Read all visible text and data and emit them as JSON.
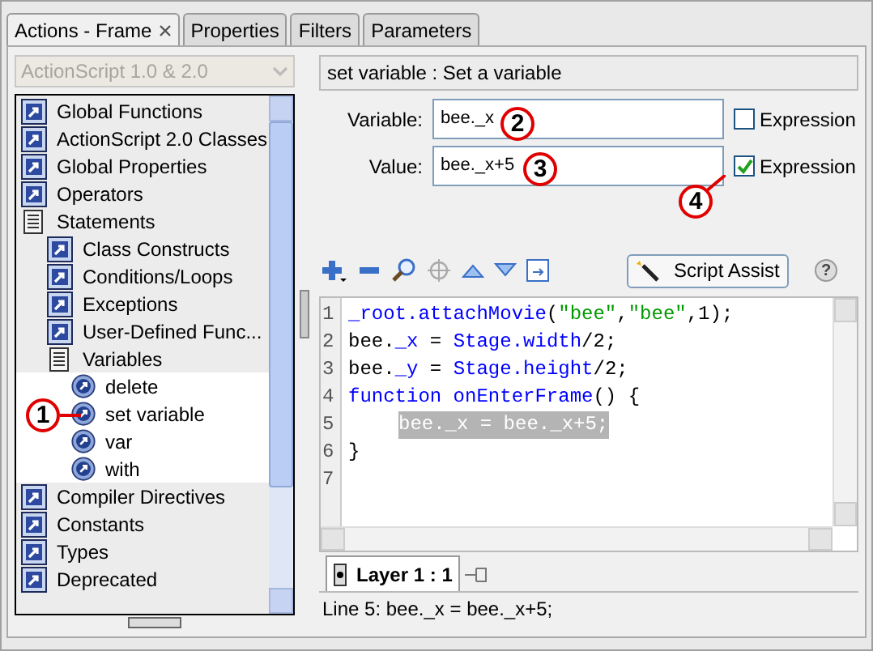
{
  "tabs": [
    {
      "label": "Actions - Frame",
      "selected": true,
      "closable": true
    },
    {
      "label": "Properties",
      "selected": false,
      "closable": false
    },
    {
      "label": "Filters",
      "selected": false,
      "closable": false
    },
    {
      "label": "Parameters",
      "selected": false,
      "closable": false
    }
  ],
  "language_select": {
    "value": "ActionScript 1.0 & 2.0",
    "disabled": true
  },
  "toolbox": [
    {
      "label": "Global Functions",
      "kind": "category"
    },
    {
      "label": "ActionScript 2.0 Classes",
      "kind": "category"
    },
    {
      "label": "Global Properties",
      "kind": "category"
    },
    {
      "label": "Operators",
      "kind": "category"
    },
    {
      "label": "Statements",
      "kind": "book",
      "children": [
        {
          "label": "Class Constructs",
          "kind": "category"
        },
        {
          "label": "Conditions/Loops",
          "kind": "category"
        },
        {
          "label": "Exceptions",
          "kind": "category"
        },
        {
          "label": "User-Defined Func...",
          "kind": "category"
        },
        {
          "label": "Variables",
          "kind": "book",
          "children": [
            {
              "label": "delete",
              "kind": "action"
            },
            {
              "label": "set variable",
              "kind": "action"
            },
            {
              "label": "var",
              "kind": "action"
            },
            {
              "label": "with",
              "kind": "action"
            }
          ]
        }
      ]
    },
    {
      "label": "Compiler Directives",
      "kind": "category"
    },
    {
      "label": "Constants",
      "kind": "category"
    },
    {
      "label": "Types",
      "kind": "category"
    },
    {
      "label": "Deprecated",
      "kind": "category"
    }
  ],
  "description": "set variable : Set a variable",
  "fields": [
    {
      "label": "Variable:",
      "value": "bee._x",
      "option": "Expression",
      "checked": false
    },
    {
      "label": "Value:",
      "value": "bee._x+5",
      "option": "Expression",
      "checked": true
    }
  ],
  "script_assist": "Script Assist",
  "help": "?",
  "code": [
    {
      "number": "1",
      "selected": false,
      "tokens": [
        {
          "kind": "keyword",
          "text": "_root.attachMovie"
        },
        {
          "kind": "plain",
          "text": "("
        },
        {
          "kind": "string",
          "text": "\"bee\""
        },
        {
          "kind": "plain",
          "text": ","
        },
        {
          "kind": "string",
          "text": "\"bee\""
        },
        {
          "kind": "plain",
          "text": ",1);"
        }
      ]
    },
    {
      "number": "2",
      "selected": false,
      "tokens": [
        {
          "kind": "plain",
          "text": "bee."
        },
        {
          "kind": "keyword",
          "text": "_x"
        },
        {
          "kind": "plain",
          "text": " = "
        },
        {
          "kind": "keyword",
          "text": "Stage.width"
        },
        {
          "kind": "plain",
          "text": "/2;"
        }
      ]
    },
    {
      "number": "3",
      "selected": false,
      "tokens": [
        {
          "kind": "plain",
          "text": "bee."
        },
        {
          "kind": "keyword",
          "text": "_y"
        },
        {
          "kind": "plain",
          "text": " = "
        },
        {
          "kind": "keyword",
          "text": "Stage.height"
        },
        {
          "kind": "plain",
          "text": "/2;"
        }
      ]
    },
    {
      "number": "4",
      "selected": false,
      "tokens": [
        {
          "kind": "keyword",
          "text": "function onEnterFrame"
        },
        {
          "kind": "plain",
          "text": "() {"
        }
      ]
    },
    {
      "number": "5",
      "selected": true,
      "indented": true,
      "tokens": [
        {
          "kind": "plain",
          "text": "bee._x = bee._x+5;"
        }
      ]
    },
    {
      "number": "6",
      "selected": false,
      "tokens": [
        {
          "kind": "plain",
          "text": "}"
        }
      ]
    },
    {
      "number": "7",
      "selected": false
    }
  ],
  "layer_tab": "Layer 1 : 1",
  "status_bar": "Line 5: bee._x = bee._x+5;",
  "callouts": [
    "1",
    "2",
    "3",
    "4"
  ]
}
